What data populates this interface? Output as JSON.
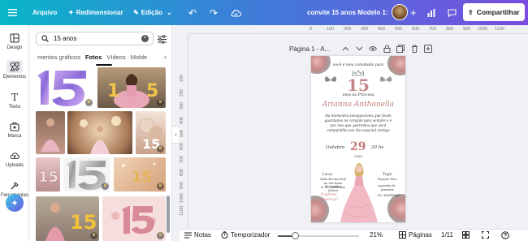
{
  "topbar": {
    "menu_file": "Arquivo",
    "resize": "Redimensionar",
    "edit": "Edição",
    "doc_title": "convite 15 anos Modelo 1:",
    "share": "Compartilhar"
  },
  "rail": {
    "items": [
      {
        "label": "Design",
        "icon": "design-icon"
      },
      {
        "label": "Elementos",
        "icon": "elements-icon"
      },
      {
        "label": "Texto",
        "icon": "text-icon"
      },
      {
        "label": "Marca",
        "icon": "brand-icon"
      },
      {
        "label": "Uploads",
        "icon": "upload-icon"
      },
      {
        "label": "Ferramentas",
        "icon": "tools-icon"
      }
    ]
  },
  "panel": {
    "search_value": "15 anos",
    "tabs": [
      "mentos gráficos",
      "Fotos",
      "Vídeos",
      "Molde"
    ],
    "active_tab": "Fotos"
  },
  "page": {
    "label": "Página 1 - A..."
  },
  "invite": {
    "line1": "você é meu convidado para",
    "number": "15",
    "subtitle": "anos da Princesa",
    "name": "Arianna Anthonella",
    "message1": "Há momentos inesquecíveis que ficam",
    "message2": "guardados no coração para sempre e é",
    "message3": "por isso que queremos que você",
    "message4": "compartilhe seu dia especial comigo",
    "month": "Outubro",
    "day": "29",
    "time": "20 hs",
    "year": "2028",
    "local_label": "Local:",
    "local1": "Salão Eventos Dinf",
    "local2": "Av. das Rosas Encantadas",
    "local3": "nº 55 - Jardim das Sonhos",
    "confirm1": "Confirme",
    "confirm2": "presença!",
    "dress_label": "Traje:",
    "dress": "Esporte Fino",
    "gift_label": "sugestão de",
    "gift": "presente",
    "pix": "Pix: XXXXXXXX"
  },
  "ruler": {
    "top": [
      "0",
      "100",
      "200",
      "300",
      "400",
      "500",
      "600",
      "700",
      "800",
      "900",
      "1000",
      "1100"
    ],
    "left": [
      "100",
      "200",
      "300",
      "400",
      "500",
      "600",
      "700",
      "800",
      "900",
      "1000",
      "1100",
      "1200",
      "1300",
      "1400",
      "1500"
    ]
  },
  "bottombar": {
    "notes": "Notas",
    "timer": "Temporizador",
    "zoom": "21%",
    "pages": "Páginas",
    "page_count": "1/11"
  },
  "colors": {
    "accent_teal": "#08b6c8",
    "accent_purple": "#7a4de0",
    "rose": "#c47a7a"
  },
  "zoom_fraction": 0.21
}
